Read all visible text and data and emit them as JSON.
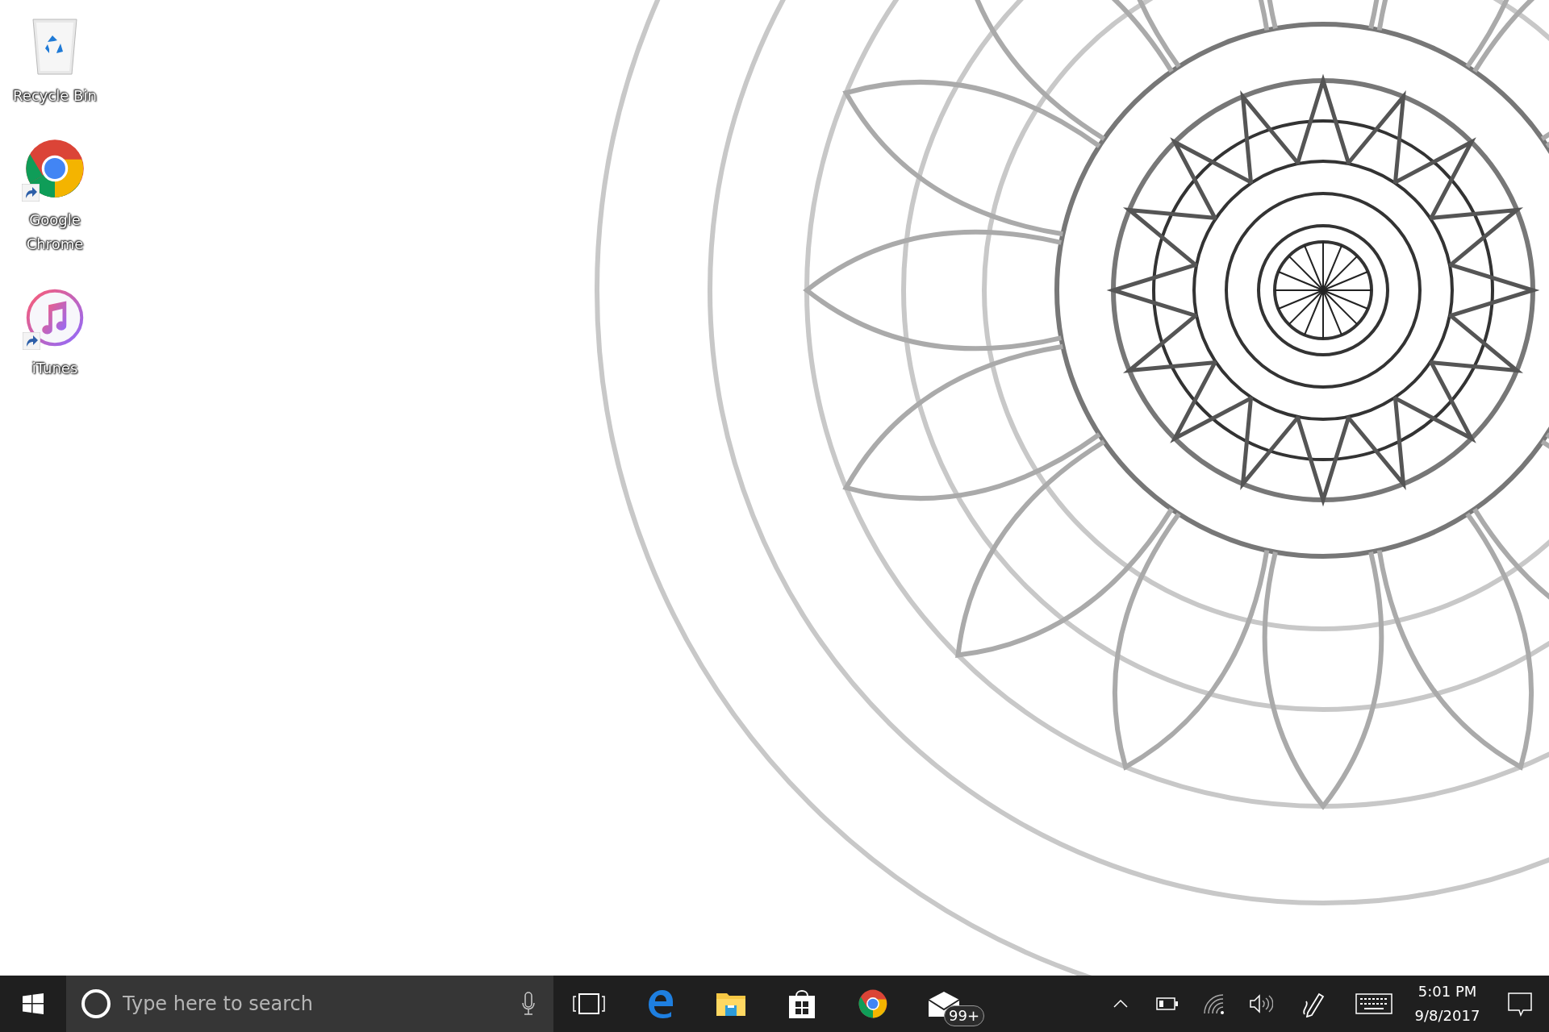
{
  "desktop_icons": [
    {
      "kind": "recycle-bin",
      "label": "Recycle Bin",
      "shortcut": false
    },
    {
      "kind": "chrome",
      "label": "Google Chrome",
      "shortcut": true
    },
    {
      "kind": "itunes",
      "label": "iTunes",
      "shortcut": true
    }
  ],
  "taskbar": {
    "search": {
      "placeholder": "Type here to search"
    },
    "apps": [
      {
        "kind": "task-view"
      },
      {
        "kind": "edge"
      },
      {
        "kind": "explorer"
      },
      {
        "kind": "store"
      },
      {
        "kind": "chrome"
      },
      {
        "kind": "mail",
        "badge": "99+"
      }
    ],
    "tray": [
      {
        "kind": "chevron"
      },
      {
        "kind": "battery"
      },
      {
        "kind": "wifi"
      },
      {
        "kind": "volume"
      },
      {
        "kind": "pen"
      },
      {
        "kind": "keyboard"
      }
    ],
    "clock": {
      "time": "5:01 PM",
      "date": "9/8/2017"
    }
  }
}
